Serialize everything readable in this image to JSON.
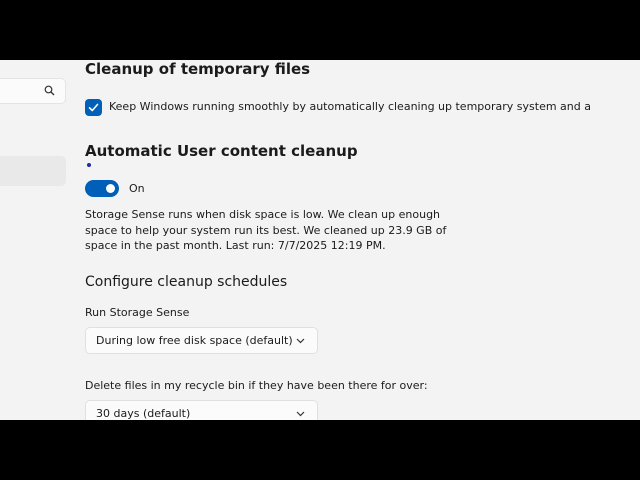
{
  "cleanup_temp": {
    "title": "Cleanup of temporary files",
    "checkbox_label": "Keep Windows running smoothly by automatically cleaning up temporary system and a",
    "checked": true
  },
  "auto_cleanup": {
    "title": "Automatic User content cleanup",
    "toggle_state": "On",
    "description": "Storage Sense runs when disk space is low. We clean up enough space to help your system run its best. We cleaned up 23.9 GB of space in the past month. Last run: 7/7/2025 12:19 PM."
  },
  "schedules": {
    "title": "Configure cleanup schedules",
    "run_label": "Run Storage Sense",
    "run_value": "During low free disk space (default)",
    "recycle_label": "Delete files in my recycle bin if they have been there for over:",
    "recycle_value": "30 days (default)"
  },
  "colors": {
    "accent": "#005fb8",
    "background": "#f3f3f3"
  }
}
